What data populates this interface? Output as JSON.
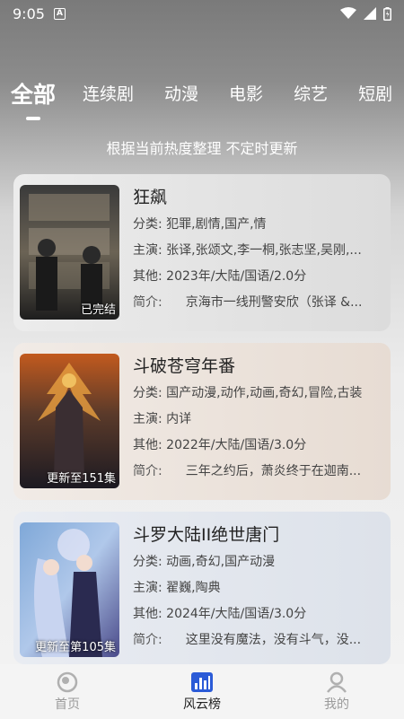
{
  "status": {
    "time": "9:05",
    "notif_letter": "A"
  },
  "tabs": [
    {
      "label": "全部"
    },
    {
      "label": "连续剧"
    },
    {
      "label": "动漫"
    },
    {
      "label": "电影"
    },
    {
      "label": "综艺"
    },
    {
      "label": "短剧"
    }
  ],
  "subtitle": "根据当前热度整理 不定时更新",
  "cards": [
    {
      "title": "狂飙",
      "badge": "已完结",
      "category": "分类:  犯罪,剧情,国产,情",
      "cast": "主演:  张译,张颂文,李一桐,张志坚,吴刚,...",
      "other": "其他:  2023年/大陆/国语/2.0分",
      "synopsis_label": "简介:",
      "synopsis": "京海市一线刑警安欣（张译 &..."
    },
    {
      "title": "斗破苍穹年番",
      "badge": "更新至151集",
      "category": "分类:  国产动漫,动作,动画,奇幻,冒险,古装",
      "cast": "主演:  内详",
      "other": "其他:  2022年/大陆/国语/3.0分",
      "synopsis_label": "简介:",
      "synopsis": "三年之约后，萧炎终于在迦南..."
    },
    {
      "title": "斗罗大陆II绝世唐门",
      "badge": "更新至第105集",
      "category": "分类:  动画,奇幻,国产动漫",
      "cast": "主演:  翟巍,陶典",
      "other": "其他:  2024年/大陆/国语/3.0分",
      "synopsis_label": "简介:",
      "synopsis": "这里没有魔法，没有斗气，没..."
    }
  ],
  "nav": [
    {
      "label": "首页",
      "icon": "home-icon"
    },
    {
      "label": "风云榜",
      "icon": "chart-icon"
    },
    {
      "label": "我的",
      "icon": "profile-icon"
    }
  ],
  "colors": {
    "accent": "#2b5bd7",
    "text": "#222222",
    "muted": "#9a9a9a"
  }
}
